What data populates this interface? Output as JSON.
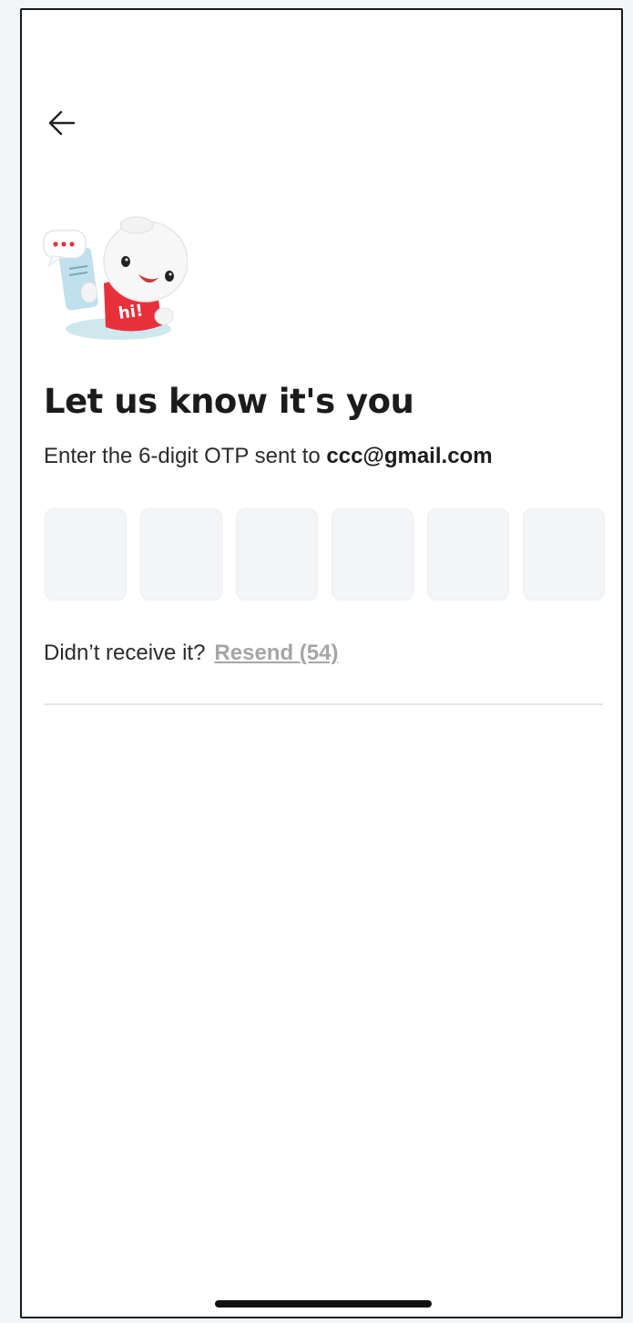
{
  "header": {
    "back_icon": "arrow-left-icon"
  },
  "mascot": {
    "shirt_text": "hi!",
    "accent_color": "#e8303a"
  },
  "main": {
    "title": "Let us know it's you",
    "subtitle_prefix": "Enter the 6-digit OTP sent to ",
    "email": "ccc@gmail.com",
    "otp_digits": [
      "",
      "",
      "",
      "",
      "",
      ""
    ],
    "resend_prompt": "Didn’t receive it?",
    "resend_label": "Resend (54)"
  },
  "colors": {
    "background": "#ffffff",
    "otp_box_fill": "#f4f5f7",
    "resend_disabled": "#a6a6a6",
    "title_text": "#1b1b1b"
  }
}
